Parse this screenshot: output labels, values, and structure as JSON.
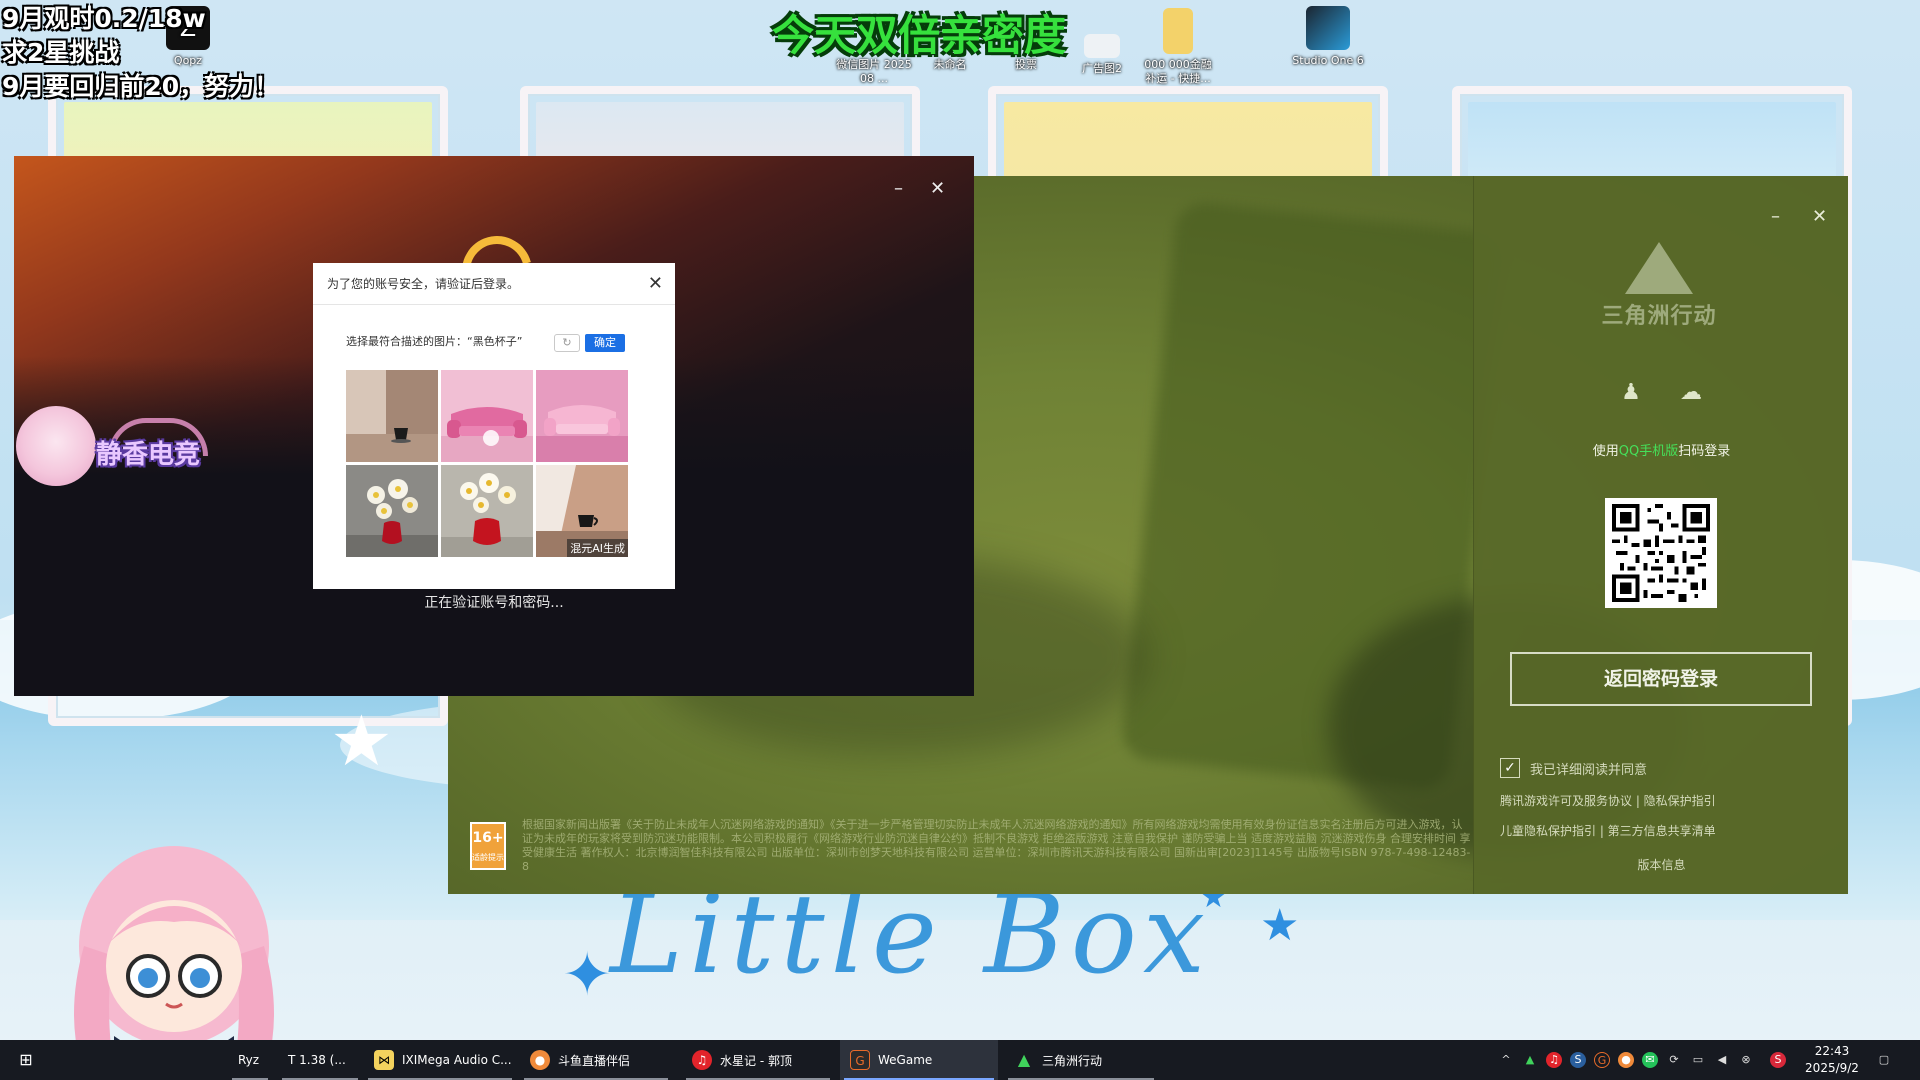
{
  "overlay": {
    "goal_line1": "9月观时0.2/18w",
    "goal_line2": "求2星挑战",
    "goal_line3": "9月要回归前20，努力！",
    "banner": "今天双倍亲密度"
  },
  "desktop_icons": [
    {
      "label": "Qopz",
      "icon": "app-icon"
    },
    {
      "label": "微信图片 2025 08 ...",
      "icon": "image-file-icon"
    },
    {
      "label": "未命名",
      "icon": "file-icon"
    },
    {
      "label": "投票",
      "icon": "file-icon"
    },
    {
      "label": "广告图2",
      "icon": "image-file-icon"
    },
    {
      "label": "000 000金融 补运 - 快捷...",
      "icon": "folder-shortcut-icon"
    },
    {
      "label": "Studio One 6",
      "icon": "studio-one-icon"
    }
  ],
  "background": {
    "handwriting": "Little Box"
  },
  "verify_window": {
    "status": "正在验证账号和密码...",
    "streamer_logo": "静香电竞",
    "minimize": "–",
    "close": "✕"
  },
  "captcha": {
    "title": "为了您的账号安全，请验证后登录。",
    "close": "✕",
    "prompt": "选择最符合描述的图片：“黑色杯子”",
    "refresh": "↻",
    "confirm": "确定",
    "ai_caption": "混元AI生成",
    "images": [
      {
        "subject": "black-cup-on-table"
      },
      {
        "subject": "pink-sofa"
      },
      {
        "subject": "pink-sofa"
      },
      {
        "subject": "white-flowers-red-vase"
      },
      {
        "subject": "white-flowers-red-vase"
      },
      {
        "subject": "black-cup-on-table"
      }
    ]
  },
  "launcher": {
    "logo": "三角洲行动",
    "minimize": "–",
    "close": "✕",
    "scan_tip_before": "使用",
    "scan_tip_highlight": "QQ手机版",
    "scan_tip_after": "扫码登录",
    "return_button": "返回密码登录",
    "agree_text": "我已详细阅读并同意",
    "links_line1": "腾讯游戏许可及服务协议 | 隐私保护指引",
    "links_line2": "儿童隐私保护指引 | 第三方信息共享清单",
    "version": "版本信息",
    "age_rating": "16+",
    "age_rating_sub": "适龄提示",
    "notice": "根据国家新闻出版署《关于防止未成年人沉迷网络游戏的通知》《关于进一步严格管理切实防止未成年人沉迷网络游戏的通知》所有网络游戏均需使用有效身份证信息实名注册后方可进入游戏，认证为未成年的玩家将受到防沉迷功能限制。本公司积极履行《网络游戏行业防沉迷自律公约》抵制不良游戏 拒绝盗版游戏 注意自我保护 谨防受骗上当 适度游戏益脑 沉迷游戏伤身 合理安排时间 享受健康生活 著作权人：北京博润智佳科技有限公司 出版单位：深圳市创梦天地科技有限公司 运营单位：深圳市腾讯天游科技有限公司 国新出审[2023]1145号 出版物号ISBN 978-7-498-12483-8",
    "accent_color": "#45e05a"
  },
  "taskbar": {
    "items": [
      {
        "label": "Ryz",
        "active": false
      },
      {
        "label": "T 1.38 (...",
        "active": false
      },
      {
        "label": "IXIMega Audio C...",
        "active": false
      },
      {
        "label": "斗鱼直播伴侣",
        "active": false
      },
      {
        "label": "水星记 - 郭顶",
        "active": false
      },
      {
        "label": "WeGame",
        "active": true
      },
      {
        "label": "三角洲行动",
        "active": false
      }
    ],
    "time": "22:43",
    "date": "2025/9/2"
  }
}
